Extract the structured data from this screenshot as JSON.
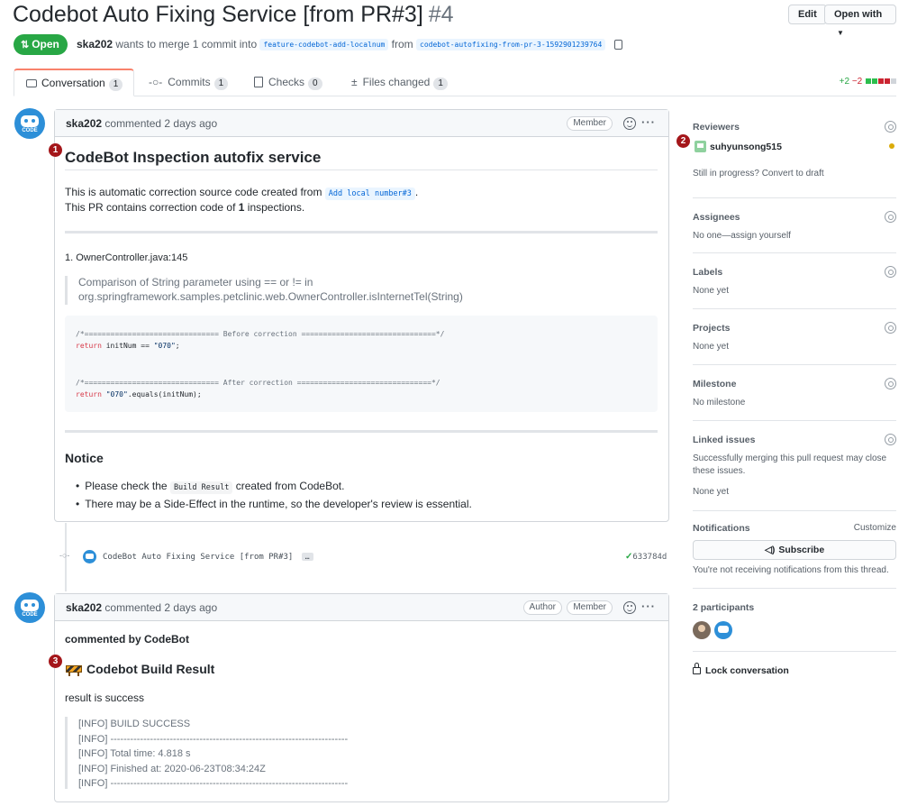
{
  "header": {
    "title": "Codebot Auto Fixing Service [from PR#3]",
    "number": "#4",
    "edit_label": "Edit",
    "open_with_label": "Open with"
  },
  "status": {
    "state": "Open",
    "author": "ska202",
    "merge_text": "wants to merge 1 commit into",
    "base_branch": "feature-codebot-add-localnum",
    "from_text": "from",
    "head_branch": "codebot-autofixing-from-pr-3-1592901239764"
  },
  "tabs": [
    {
      "label": "Conversation",
      "count": "1"
    },
    {
      "label": "Commits",
      "count": "1"
    },
    {
      "label": "Checks",
      "count": "0"
    },
    {
      "label": "Files changed",
      "count": "1"
    }
  ],
  "diffstat": {
    "additions": "+2",
    "deletions": "−2"
  },
  "colors": {
    "accent": "#f9826c",
    "open": "#28a745",
    "link": "#0366d6",
    "marker": "#a4161a"
  },
  "comment1": {
    "author": "ska202",
    "action": "commented 2 days ago",
    "role": "Member",
    "marker": "1",
    "heading": "CodeBot Inspection autofix service",
    "line1_pre": "This is automatic correction source code created from",
    "line1_code": "Add local number#3",
    "line1_post": ".",
    "line2_pre": "This PR contains correction code of",
    "line2_bold": "1",
    "line2_post": "inspections.",
    "item_title": "1. OwnerController.java:145",
    "quote_line1": "Comparison of String parameter using == or != in",
    "quote_line2": "org.springframework.samples.petclinic.web.OwnerController.isInternetTel(String)",
    "code": {
      "before_comment": "/*=============================== Before correction ===============================*/",
      "before_kw": "return",
      "before_rest": " initNum == ",
      "before_str": "\"070\"",
      "before_end": ";",
      "after_comment": "/*=============================== After correction ===============================*/",
      "after_kw": "return",
      "after_str": " \"070\"",
      "after_rest": ".equals(initNum);"
    },
    "notice_heading": "Notice",
    "notice1_pre": "Please check the",
    "notice1_code": "Build Result",
    "notice1_post": "created from CodeBot.",
    "notice2": "There may be a Side-Effect in the runtime, so the developer's review is essential."
  },
  "commit": {
    "message": "CodeBot Auto Fixing Service [from PR#3]",
    "ellipsis": "…",
    "sha": "633784d"
  },
  "comment2": {
    "author": "ska202",
    "action": "commented 2 days ago",
    "role1": "Author",
    "role2": "Member",
    "marker": "3",
    "by": "commented by CodeBot",
    "heading": "Codebot Build Result",
    "result": "result is success",
    "log": [
      "[INFO] BUILD SUCCESS",
      "[INFO] ------------------------------------------------------------------------",
      "[INFO] Total time: 4.818 s",
      "[INFO] Finished at: 2020-06-23T08:34:24Z",
      "[INFO] ------------------------------------------------------------------------"
    ]
  },
  "sidebar": {
    "reviewers_label": "Reviewers",
    "reviewer": "suhyunsong515",
    "reviewer_marker": "2",
    "draft_text": "Still in progress? Convert to draft",
    "assignees_label": "Assignees",
    "assignees_value": "No one—assign yourself",
    "labels_label": "Labels",
    "labels_value": "None yet",
    "projects_label": "Projects",
    "projects_value": "None yet",
    "milestone_label": "Milestone",
    "milestone_value": "No milestone",
    "linked_label": "Linked issues",
    "linked_text1": "Successfully merging this pull request may close",
    "linked_text2": "these issues.",
    "linked_value": "None yet",
    "notifications_label": "Notifications",
    "customize_label": "Customize",
    "subscribe_label": "Subscribe",
    "notif_text": "You're not receiving notifications from this thread.",
    "participants_label": "2 participants",
    "lock_label": "Lock conversation"
  }
}
